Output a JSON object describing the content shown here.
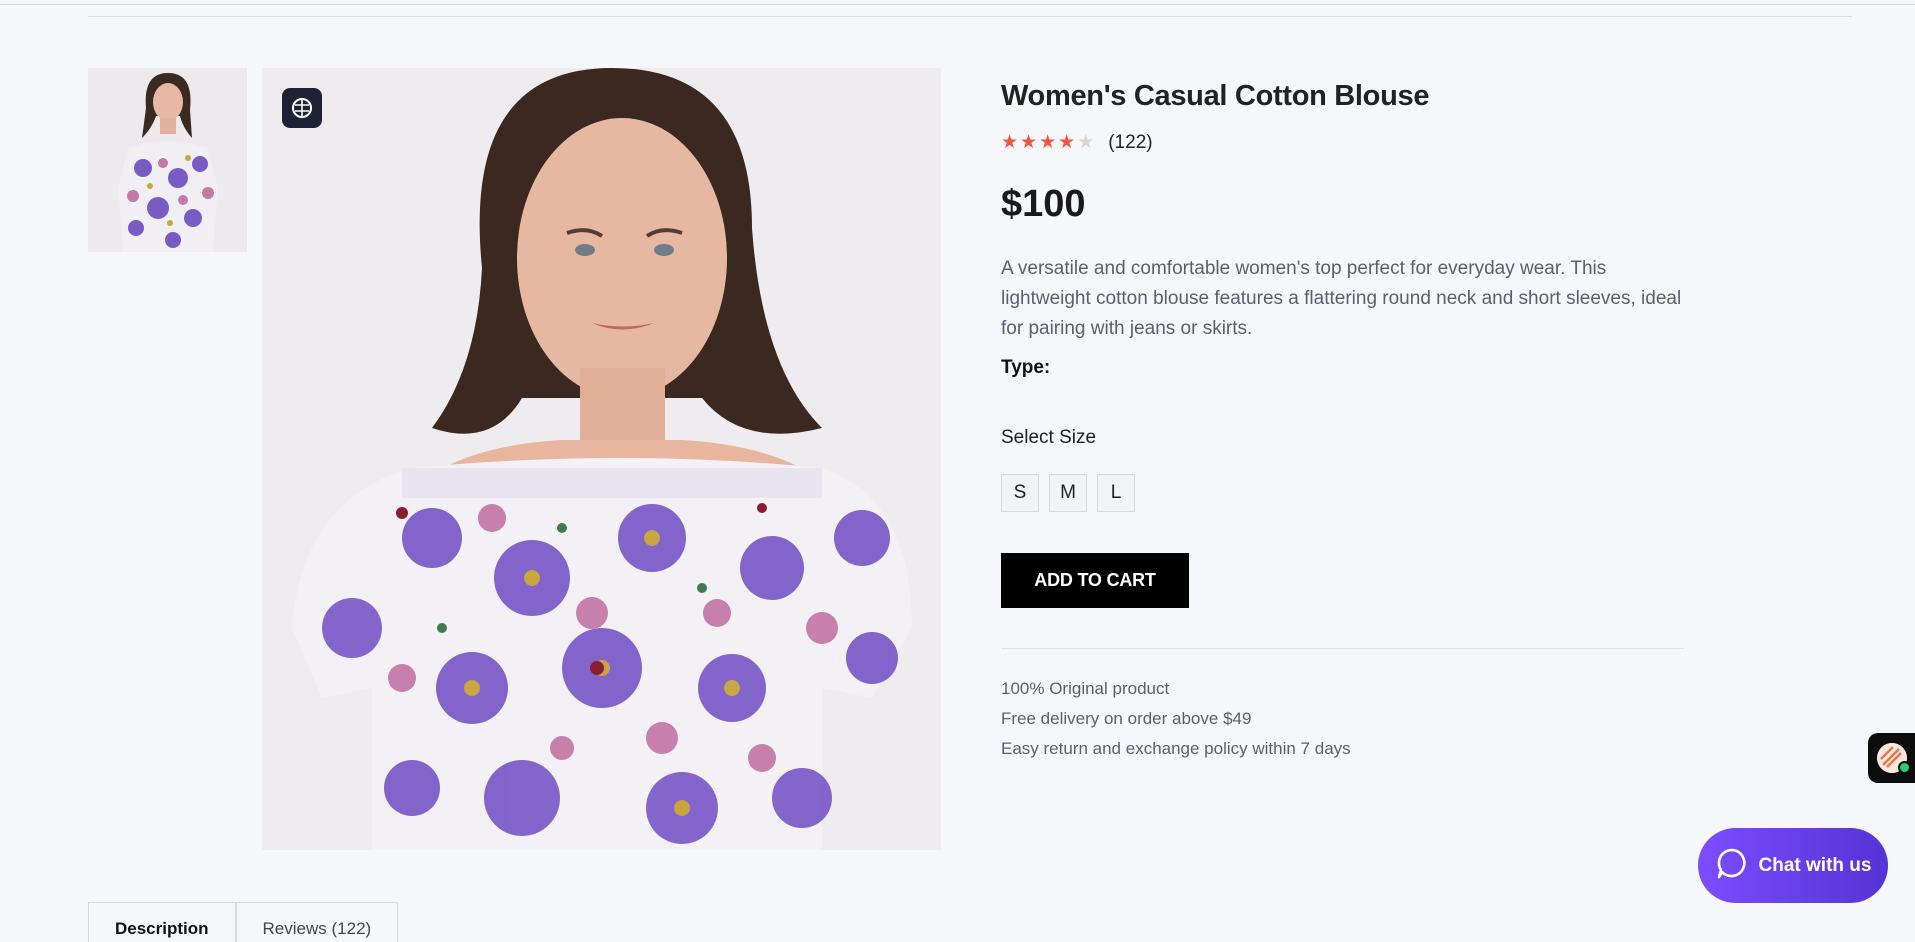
{
  "product": {
    "title": "Women's Casual Cotton Blouse",
    "rating": 4,
    "rating_max": 5,
    "review_count": "(122)",
    "price": "$100",
    "description": "A versatile and comfortable women's top perfect for everyday wear. This lightweight cotton blouse features a flattering round neck and short sleeves, ideal for pairing with jeans or skirts.",
    "type_label": "Type:",
    "size_label": "Select Size",
    "sizes": [
      "S",
      "M",
      "L"
    ],
    "add_to_cart": "ADD TO CART",
    "features": [
      "100% Original product",
      "Free delivery on order above $49",
      "Easy return and exchange policy within 7 days"
    ]
  },
  "tabs": [
    {
      "label": "Description"
    },
    {
      "label": "Reviews (122)"
    }
  ],
  "chat": {
    "label": "Chat with us"
  },
  "colors": {
    "accent_star": "#f4533d",
    "chat_gradient_start": "#7c4dff",
    "chat_gradient_end": "#5533d4",
    "button_bg": "#000000"
  },
  "icons": {
    "ai_badge": "brain-icon",
    "chat": "chat-bubble-icon"
  }
}
